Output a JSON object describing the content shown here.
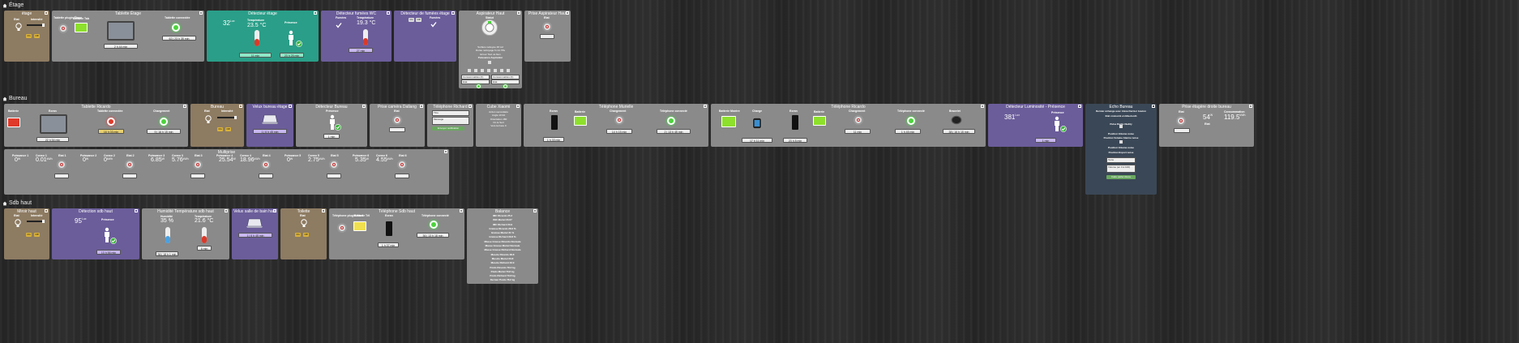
{
  "sections": {
    "etage": "Étage",
    "bureau": "Bureau",
    "sdb": "Sdb haut"
  },
  "etage": {
    "etage_tile": {
      "title": "étage",
      "lbl_etat": "Etat",
      "lbl_intensite": "Intensité",
      "on": "On",
      "off": "Off"
    },
    "tablette": {
      "title": "Tablette Étage",
      "lbl_tablette": "Tablette plugin Étage",
      "lbl_batterie": "Batterie Tab",
      "lbl_connect": "Tablette connectée",
      "badge1": "2 h 44 min",
      "badge2": "62 j 23 h 35 min"
    },
    "detecteur": {
      "title": "Détecteur étage",
      "lum_val": "32",
      "lum_unit": "Lux",
      "lbl_temp": "Température",
      "temp": "23.5 °C",
      "lbl_presence": "Présence",
      "badge1": "11 min",
      "badge2": "23 h 25 min"
    },
    "fumee_wc": {
      "title": "Détecteur fumées WC",
      "lbl_fumees": "Fumées",
      "lbl_temp": "Température",
      "temp": "19.3 °C",
      "badge": "27 min"
    },
    "fumee_etage": {
      "title": "Détecteur de fumées étage",
      "on": "On",
      "off": "Off",
      "lbl_fumees": "Fumées"
    },
    "aspi": {
      "title": "Aspirateur Haut",
      "lbl_statut": "Statut",
      "line1": "Surface nettoyée 48 m2",
      "line2": "Durée nettoyage 6 min 55s",
      "line3": "Erreur Tout va bien",
      "line4": "Puissance Aspiration",
      "field1": "Consommables (h)",
      "field2": "Etat",
      "field3": "Consommables (h)",
      "field4": "Etat"
    },
    "prise_aspi": {
      "title": "Prise Aspirateur Haut",
      "lbl_etat": "Etat"
    }
  },
  "bureau": {
    "tab_ricardo": {
      "title": "Tablette Ricardo",
      "lbl_batterie": "Batterie",
      "lbl_ecran": "Ecran",
      "lbl_connect": "Tablette connectée",
      "lbl_chargement": "Chargement",
      "badge1": "22 h 54 min",
      "badge2": "16 h 03 min",
      "badge3": "9 j 16 h 15 min"
    },
    "bureau_tile": {
      "title": "Bureau",
      "lbl_etat": "Etat",
      "lbl_intensite": "Intensité",
      "on": "On",
      "off": "Off"
    },
    "velux": {
      "title": "Velux bureau étage",
      "badge": "1 j 6 h 45 min"
    },
    "det_bureau": {
      "title": "Détecteur Bureau",
      "lbl_presence": "Présence",
      "badge": "1 min"
    },
    "prise_cam": {
      "title": "Prise caméra Dallang",
      "lbl_etat": "Etat"
    },
    "tel_richard": {
      "title": "Téléphone Richard",
      "field1": "Titre",
      "field2": "Message",
      "button": "Envoyer notification"
    },
    "cube": {
      "title": "Cube Xiaomi",
      "line1": "Action secondaire",
      "line2": "Angle 10.94",
      "line3": "Orientation 180",
      "line4": "On le Sert",
      "line5": "Vers la Face 0"
    },
    "tel_muriele": {
      "title": "Téléphone Murielle",
      "lbl_ecran": "Ecran",
      "lbl_batterie": "Batterie",
      "lbl_chargement": "Chargement",
      "lbl_connect": "Téléphone connecté",
      "badge1": "1 h 33 min",
      "badge2": "14 h 15 min",
      "badge3": "2 j 13 h 45 min"
    },
    "tel_ricardo": {
      "title": "Téléphone Ricardo",
      "lbl_batterie": "Batterie Montre",
      "lbl_charge": "Charge",
      "lbl_ecran": "Ecran",
      "lbl_batterie2": "Batterie",
      "lbl_chargement": "Chargement",
      "lbl_connect": "Téléphone connecté",
      "lbl_bracelet": "Bracelet",
      "badge1": "17 h 11 min",
      "badge2": "23 h 8 min",
      "badge3": "11 min",
      "badge4": "1 h 45 min",
      "badge5": "38 j 16 h 15 min"
    },
    "det_lum": {
      "title": "Détecteur Luminosité - Présence",
      "lum_val": "381",
      "lum_unit": "Lux",
      "lbl_presence": "Présence",
      "badge": "1 min"
    },
    "echo": {
      "title": "Echo Bureau",
      "line1": "Dernier échange avec Alexa Dernier bouton",
      "line2": "Etat connecté en Bluetooth",
      "line3": "Pulse Radio Nudity",
      "line4": "Position Volume noise",
      "line5": "Position Volume Alarme noise",
      "line6": "Position Volume noise",
      "line7": "Position Export noise",
      "field1": "Texte",
      "field2": "Volume (en 0 à 100)",
      "button": "Faire parler Alexa"
    },
    "prise_droite": {
      "title": "Prise étagère droite bureau",
      "lbl_etat": "Etat",
      "val1": "54",
      "unit1": "W",
      "lbl_cons": "Consommation",
      "val2": "119.5",
      "unit2": "kWh",
      "lbl_etat2": "Etat"
    },
    "multiprise": {
      "title": "Multiprise",
      "cols": [
        {
          "lp": "Puissance 1",
          "pv": "0",
          "pu": "W",
          "lc": "Conso 1",
          "cv": "0.01",
          "cu": "kWh",
          "le": "Etat 1"
        },
        {
          "lp": "Puissance 2",
          "pv": "0",
          "pu": "W",
          "lc": "Conso 2",
          "cv": "0",
          "cu": "kWh",
          "le": "Etat 2"
        },
        {
          "lp": "Puissance 3",
          "pv": "6.85",
          "pu": "W",
          "lc": "Conso 3",
          "cv": "5.76",
          "cu": "kWh",
          "le": "Etat 3"
        },
        {
          "lp": "Puissance 4",
          "pv": "25.54",
          "pu": "W",
          "lc": "Conso 4",
          "cv": "18.96",
          "cu": "kWh",
          "le": "Etat 4"
        },
        {
          "lp": "Puissance 5",
          "pv": "0",
          "pu": "W",
          "lc": "Conso 5",
          "cv": "2.75",
          "cu": "kWh",
          "le": "Etat 5"
        },
        {
          "lp": "Puissance 6",
          "pv": "5.35",
          "pu": "W",
          "lc": "Conso 6",
          "cv": "4.55",
          "cu": "kWh",
          "le": "Etat 6"
        }
      ]
    }
  },
  "sdb": {
    "miroir": {
      "title": "Miroir haut",
      "lbl_etat": "Etat",
      "lbl_intensite": "Intensité",
      "on": "On",
      "off": "Off"
    },
    "detection": {
      "title": "Détection sdb haut",
      "lum_val": "95",
      "lum_unit": "Lux",
      "lbl_presence": "Présence",
      "badge": "13 h 56 min"
    },
    "humidite": {
      "title": "Humidité Température sdb haut",
      "lbl_hum": "Humidité",
      "hum": "35 %",
      "lbl_temp": "Température",
      "temp": "21.6 °C",
      "badge1": "36 j 18 h 1 min",
      "badge2": "6 min"
    },
    "velux": {
      "title": "Velux salle de bain haut",
      "badge": "1 j 6 h 45 min"
    },
    "toilette": {
      "title": "Toilette",
      "lbl_etat": "Etat",
      "on": "On",
      "off": "Off"
    },
    "tel_sdb": {
      "title": "Téléphone Sdb haut",
      "lbl_tel": "Téléphone plugin Haut",
      "lbl_batterie": "Batterie Tél",
      "lbl_ecran": "Ecran",
      "lbl_connect": "Téléphone connecté",
      "badge1": "1 h 37 min",
      "badge2": "36 j 13 h 18 min"
    },
    "balance": {
      "title": "Balance",
      "lines": [
        "IMC Ricardo 25.2",
        "IMC Muriel 23.67",
        "IMC Richard 23.9",
        "Graisse Ricardo 28.6 %",
        "Graisse Muriel 31 %",
        "Graisse Richard 29.8 %",
        "Masse Grasse Ricardo Normale",
        "Masse Grasse Muriel Normale",
        "Masse Grasse Richard Normale",
        "Muscle Ricardo 38.8",
        "Muscle Muriel 33.8",
        "Muscle Richard 33.9",
        "Poids Ricardo 78.2 kg",
        "Poids Muriel 70.8 kg",
        "Poids Richard 79.8 kg",
        "Dernier Poids 78.2 kg"
      ]
    }
  },
  "colors": {
    "gray": "#8a8a8a",
    "brown": "#8d7b62",
    "teal": "#2a9e88",
    "purple": "#6b5d9a",
    "dark": "#3a4756"
  }
}
